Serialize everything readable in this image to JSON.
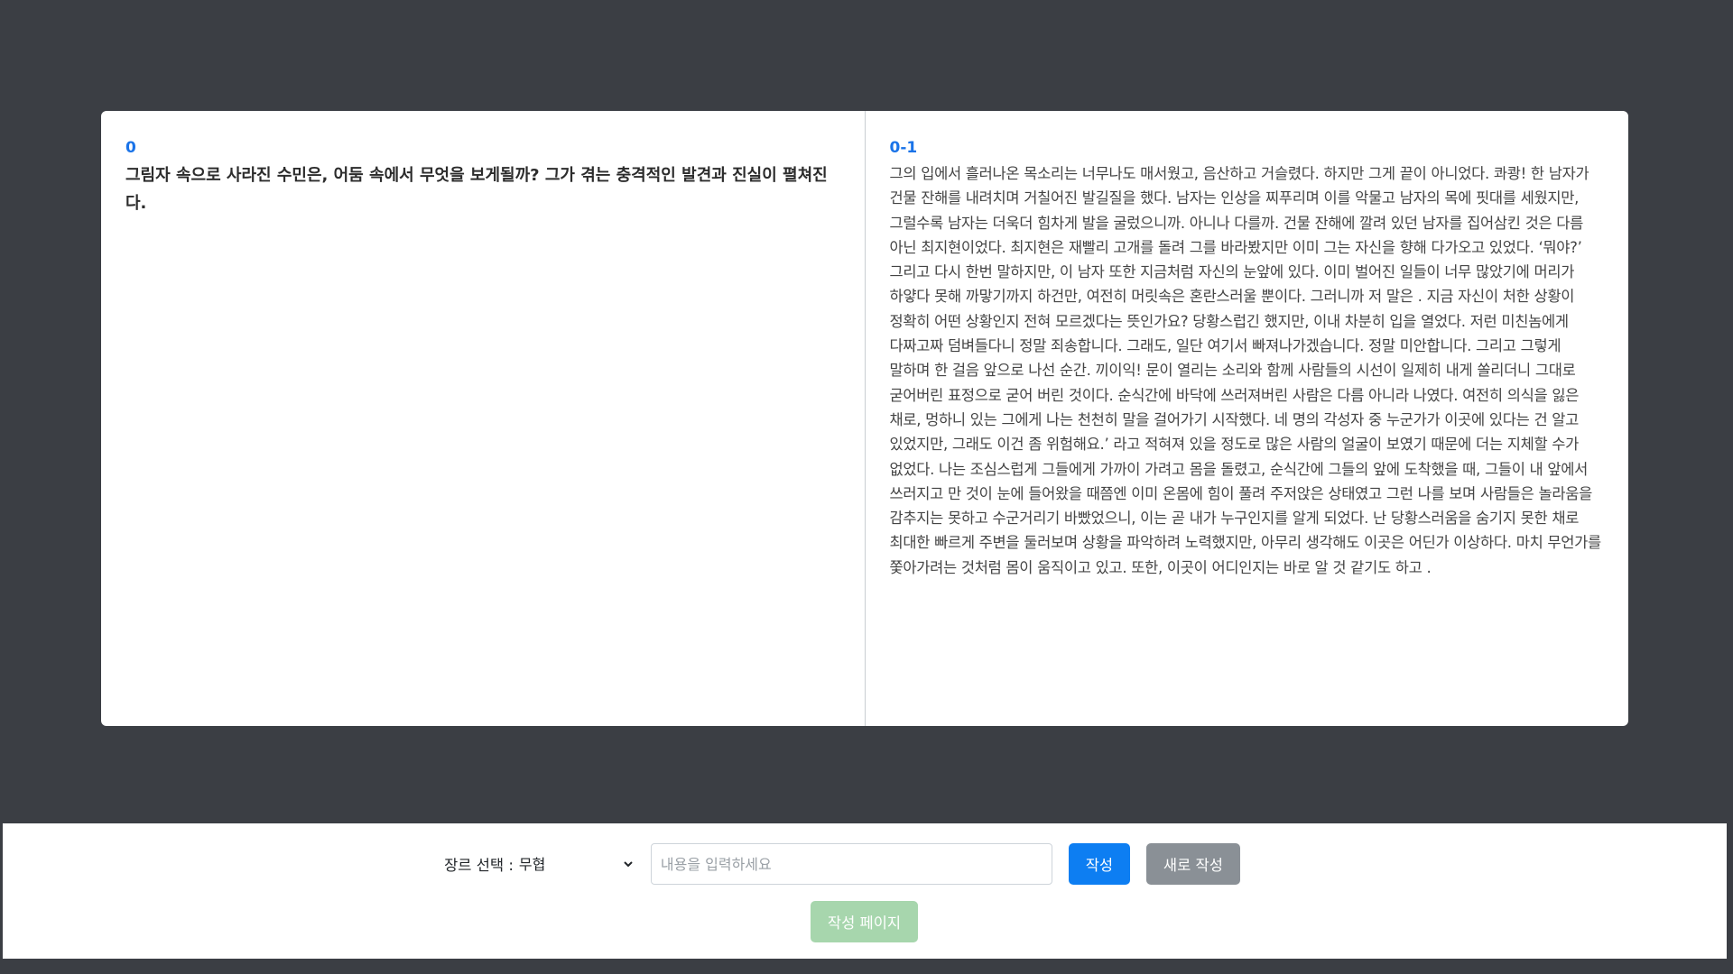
{
  "left_page": {
    "label": "0",
    "text": "그림자 속으로 사라진 수민은, 어둠 속에서 무엇을 보게될까? 그가 겪는 충격적인 발견과 진실이 펼쳐진다."
  },
  "right_page": {
    "label": "0-1",
    "text": "그의 입에서 흘러나온 목소리는 너무나도 매서웠고, 음산하고 거슬렸다. 하지만 그게 끝이 아니었다. 콰쾅! 한 남자가 건물 잔해를 내려치며 거칠어진 발길질을 했다. 남자는 인상을 찌푸리며 이를 악물고 남자의 목에 핏대를 세웠지만, 그럴수록 남자는 더욱더 힘차게 발을 굴렀으니까. 아니나 다를까. 건물 잔해에 깔려 있던 남자를 집어삼킨 것은 다름 아닌 최지현이었다. 최지현은 재빨리 고개를 돌려 그를 바라봤지만 이미 그는 자신을 향해 다가오고 있었다. ‘뭐야?’ 그리고 다시 한번 말하지만, 이 남자 또한 지금처럼 자신의 눈앞에 있다. 이미 벌어진 일들이 너무 많았기에 머리가 하얗다 못해 까맣기까지 하건만, 여전히 머릿속은 혼란스러울 뿐이다. 그러니까 저 말은 . 지금 자신이 처한 상황이 정확히 어떤 상황인지 전혀 모르겠다는 뜻인가요? 당황스럽긴 했지만, 이내 차분히 입을 열었다. 저런 미친놈에게 다짜고짜 덤벼들다니 정말 죄송합니다. 그래도, 일단 여기서 빠져나가겠습니다. 정말 미안합니다. 그리고 그렇게 말하며 한 걸음 앞으로 나선 순간. 끼이익! 문이 열리는 소리와 함께 사람들의 시선이 일제히 내게 쏠리더니 그대로 굳어버린 표정으로 굳어 버린 것이다. 순식간에 바닥에 쓰러져버린 사람은 다름 아니라 나였다. 여전히 의식을 잃은 채로, 멍하니 있는 그에게 나는 천천히 말을 걸어가기 시작했다. 네 명의 각성자 중 누군가가 이곳에 있다는 건 알고 있었지만, 그래도 이건 좀 위험해요.’ 라고 적혀져 있을 정도로 많은 사람의 얼굴이 보였기 때문에 더는 지체할 수가 없었다. 나는 조심스럽게 그들에게 가까이 가려고 몸을 돌렸고, 순식간에 그들의 앞에 도착했을 때, 그들이 내 앞에서 쓰러지고 만 것이 눈에 들어왔을 때쯤엔 이미 온몸에 힘이 풀려 주저앉은 상태였고 그런 나를 보며 사람들은 놀라움을 감추지는 못하고 수군거리기 바빴었으니, 이는 곧 내가 누구인지를 알게 되었다. 난 당황스러움을 숨기지 못한 채로 최대한 빠르게 주변을 둘러보며 상황을 파악하려 노력했지만, 아무리 생각해도 이곳은 어딘가 이상하다. 마치 무언가를 쫓아가려는 것처럼 몸이 움직이고 있고. 또한, 이곳이 어디인지는 바로 알 것 같기도 하고 ."
  },
  "controls": {
    "genre_label": "장르 선택 :",
    "genre_selected": "무협",
    "content_placeholder": "내용을 입력하세요",
    "write_button": "작성",
    "new_write_button": "새로 작성",
    "write_page_button": "작성 페이지"
  },
  "colors": {
    "background": "#3b3e44",
    "accent": "#0d7ef2",
    "label_blue": "#1a73e8",
    "secondary_button": "#8a9096",
    "disabled_green": "#a7d6ad"
  }
}
